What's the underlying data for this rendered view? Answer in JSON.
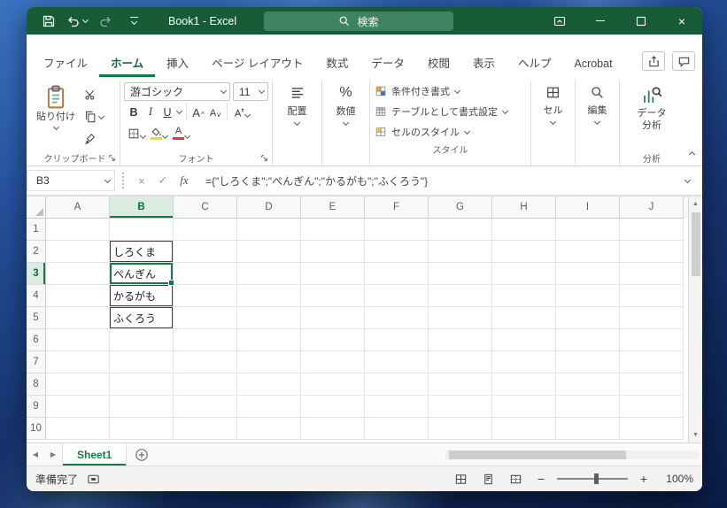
{
  "titlebar": {
    "title": "Book1 - Excel",
    "search_placeholder": "検索"
  },
  "ribbon": {
    "tabs": [
      {
        "id": "file",
        "label": "ファイル",
        "active": false
      },
      {
        "id": "home",
        "label": "ホーム",
        "active": true
      },
      {
        "id": "insert",
        "label": "挿入",
        "active": false
      },
      {
        "id": "page-layout",
        "label": "ページ レイアウト",
        "active": false
      },
      {
        "id": "formulas",
        "label": "数式",
        "active": false
      },
      {
        "id": "data",
        "label": "データ",
        "active": false
      },
      {
        "id": "review",
        "label": "校閲",
        "active": false
      },
      {
        "id": "view",
        "label": "表示",
        "active": false
      },
      {
        "id": "help",
        "label": "ヘルプ",
        "active": false
      },
      {
        "id": "acrobat",
        "label": "Acrobat",
        "active": false
      }
    ],
    "clipboard": {
      "group_label": "クリップボード",
      "paste_label": "貼り付け"
    },
    "font": {
      "group_label": "フォント",
      "font_name": "游ゴシック",
      "font_size": "11"
    },
    "alignment_label": "配置",
    "number_label": "数値",
    "styles": {
      "group_label": "スタイル",
      "conditional": "条件付き書式",
      "format_table": "テーブルとして書式設定",
      "cell_styles": "セルのスタイル"
    },
    "cells_label": "セル",
    "editing_label": "編集",
    "analysis": {
      "group_label": "分析",
      "button_line1": "データ",
      "button_line2": "分析"
    }
  },
  "formula_bar": {
    "name_box": "B3",
    "fx": "fx",
    "formula": "={\"しろくま\";\"ぺんぎん\";\"かるがも\";\"ふくろう\"}"
  },
  "grid": {
    "columns": [
      "A",
      "B",
      "C",
      "D",
      "E",
      "F",
      "G",
      "H",
      "I",
      "J"
    ],
    "rows": [
      "1",
      "2",
      "3",
      "4",
      "5",
      "6",
      "7",
      "8",
      "9",
      "10"
    ],
    "selected_column": "B",
    "selected_row": "3",
    "active_cell": "B3",
    "bordered_range": [
      "B2",
      "B3",
      "B4",
      "B5"
    ],
    "cells": {
      "B2": "しろくま",
      "B3": "ぺんぎん",
      "B4": "かるがも",
      "B5": "ふくろう"
    }
  },
  "sheet_bar": {
    "tabs": [
      {
        "name": "Sheet1",
        "active": true
      }
    ]
  },
  "status_bar": {
    "ready": "準備完了",
    "zoom_level": "100%"
  },
  "icons": {
    "bold": "B",
    "italic": "I",
    "underline": "U",
    "letter_a": "A",
    "percent": "%",
    "cancel": "×",
    "check": "✓",
    "close": "×",
    "scroll_up": "▲",
    "scroll_down": "▼",
    "scroll_left": "◀",
    "scroll_right": "▶",
    "zoom_out": "−",
    "zoom_in": "+"
  },
  "colors": {
    "accent": "#107C41",
    "titlebar_green": "#185C37"
  }
}
